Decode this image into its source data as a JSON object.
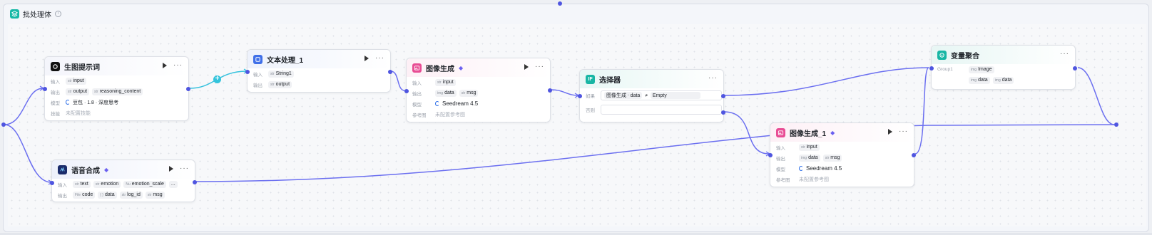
{
  "batch": {
    "title": "批处理体",
    "info": "i"
  },
  "colors": {
    "accent": "#4f55e0",
    "teal": "#17b8a6",
    "edge": "#6b6ff0",
    "edge_light": "#35c2de",
    "pink": "#e84c94",
    "blue": "#2c6ee8"
  },
  "nodes": {
    "prompt": {
      "title": "生图提示词",
      "icon": "openai-icon",
      "rows": [
        {
          "label": "输入",
          "tags": [
            {
              "t": "str",
              "v": "input"
            }
          ]
        },
        {
          "label": "输出",
          "tags": [
            {
              "t": "str",
              "v": "output"
            },
            {
              "t": "str",
              "v": "reasoning_content"
            }
          ]
        },
        {
          "label": "模型",
          "model": "豆包 · 1.8 · 深度思考"
        },
        {
          "label": "技能",
          "muted": "未配置技能"
        }
      ]
    },
    "text": {
      "title": "文本处理_1",
      "icon": "text-process-icon",
      "rows": [
        {
          "label": "输入",
          "tags": [
            {
              "t": "str",
              "v": "String1"
            }
          ]
        },
        {
          "label": "输出",
          "tags": [
            {
              "t": "str",
              "v": "output"
            }
          ]
        }
      ]
    },
    "img1": {
      "title": "图像生成",
      "icon": "image-icon",
      "rows": [
        {
          "label": "输入",
          "tags": [
            {
              "t": "str",
              "v": "input"
            }
          ]
        },
        {
          "label": "输出",
          "tags": [
            {
              "t": "img",
              "v": "data"
            },
            {
              "t": "str",
              "v": "msg"
            }
          ]
        },
        {
          "label": "模型",
          "model": "Seedream 4.5"
        },
        {
          "label": "参考图",
          "muted": "未配置参考图"
        }
      ]
    },
    "selector": {
      "title": "选择器",
      "icon": "if-icon",
      "if_label": "如果",
      "else_label": "否则",
      "cond_left_a": "图像生成",
      "cond_left_b": "data",
      "cond_op": "≠",
      "cond_right": "Empty"
    },
    "tts": {
      "title": "语音合成",
      "icon": "voice-icon",
      "rows": [
        {
          "label": "输入",
          "tags": [
            {
              "t": "str",
              "v": "text"
            },
            {
              "t": "str",
              "v": "emotion"
            },
            {
              "t": "Nu",
              "v": "emotion_scale"
            }
          ],
          "more": "..."
        },
        {
          "label": "输出",
          "tags": [
            {
              "t": "File",
              "v": "code"
            },
            {
              "t": "{ }",
              "v": "data"
            },
            {
              "t": "str",
              "v": "log_id"
            },
            {
              "t": "str",
              "v": "msg"
            }
          ]
        }
      ]
    },
    "agg": {
      "title": "变量聚合",
      "icon": "aggregate-icon",
      "rows": [
        {
          "label": "Group1",
          "tags": [
            {
              "t": "img",
              "v": "Image"
            }
          ]
        },
        {
          "label": "",
          "tags": [
            {
              "t": "img",
              "v": "data"
            },
            {
              "t": "img",
              "v": "data"
            }
          ]
        }
      ]
    },
    "img2": {
      "title": "图像生成_1",
      "icon": "image-icon",
      "rows": [
        {
          "label": "输入",
          "tags": [
            {
              "t": "str",
              "v": "input"
            }
          ]
        },
        {
          "label": "输出",
          "tags": [
            {
              "t": "img",
              "v": "data"
            },
            {
              "t": "str",
              "v": "msg"
            }
          ]
        },
        {
          "label": "模型",
          "model": "Seedream 4.5"
        },
        {
          "label": "参考图",
          "muted": "未配置参考图"
        }
      ]
    }
  }
}
